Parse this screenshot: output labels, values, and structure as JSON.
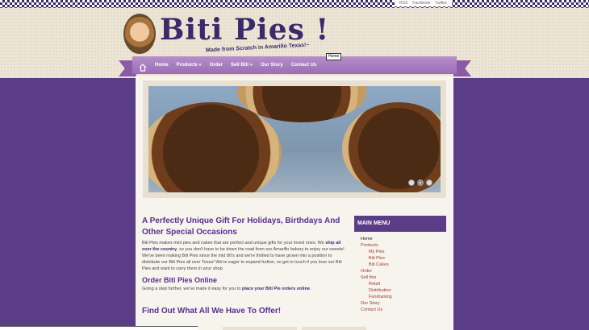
{
  "header": {
    "title": "Biti Pies !",
    "tagline": "Made from Scratch in Amarillo Texas!~",
    "social": [
      "RSS",
      "Facebook",
      "Twitter"
    ],
    "tooltip": "Home"
  },
  "nav": {
    "items": [
      "Home",
      "Products »",
      "Order",
      "Sell Biti »",
      "Our Story",
      "Contact Us"
    ]
  },
  "main": {
    "heading": "A Perfectly Unique Gift For Holidays, Birthdays And Other Special Occasions",
    "para1_a": "Biti Pies makes mini pies and cakes that are perfect and unique gifts for your loved ones. We ",
    "para1_link": "ship all over the country",
    "para1_b": ", so you don't have to be down the road from our Amarillo bakery to enjoy our sweets! We've been making Biti Pies since the mid 80's and we're thrilled to have grown into a position to distribute our Biti Pies all over Texas! We're eager to expand further, so get in touch if you love our Biti Pies and want to carry them in your shop.",
    "subheading": "Order Biti Pies Online",
    "para2_a": "Going a step further, we've made it easy for you to ",
    "para2_link": "place your Biti Pie orders online",
    "para2_b": ".",
    "offer_heading": "Find Out What All We Have To Offer!"
  },
  "sidebar": {
    "title": "MAIN MENU",
    "items": {
      "home": "Home",
      "products": "Products",
      "my_pies": "My Pies",
      "biti_pies": "Biti Pies",
      "biti_cakes": "Biti Cakes",
      "order": "Order",
      "sell_this": "Sell this",
      "retail": "Retail",
      "distribution": "Distribution",
      "fundraising": "Fundraising",
      "our_story": "Our Story",
      "contact_us": "Contact Us"
    }
  },
  "colors": {
    "purple": "#5a3d86",
    "nav": "#9c6db6",
    "heading": "#5a2d91"
  }
}
